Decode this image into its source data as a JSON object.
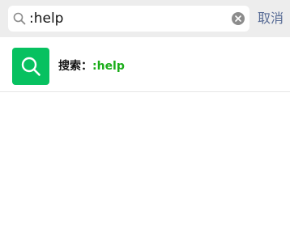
{
  "search": {
    "value": ":help",
    "cancel_label": "取消"
  },
  "result": {
    "label": "搜索：",
    "query": ":help"
  },
  "icons": {
    "search": "search-icon",
    "clear": "clear-icon",
    "result": "search-icon"
  },
  "colors": {
    "header_bg": "#ededed",
    "accent_green": "#07c160",
    "query_green": "#1aad19",
    "cancel_blue": "#576b95"
  }
}
